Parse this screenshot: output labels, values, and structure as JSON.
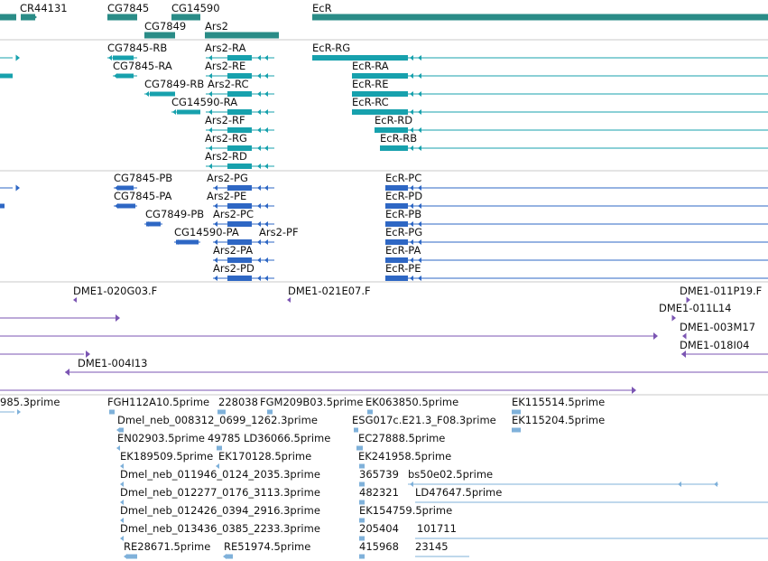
{
  "colors": {
    "gene": "#2a8c87",
    "transcript": "#17a1ad",
    "protein": "#2e67c4",
    "clone": "#7b55b3",
    "est": "#7fb1da",
    "separator": "#c8c8c8",
    "label": "#111111"
  },
  "icons": {
    "strand-forward": "small arrowhead pointing right",
    "strand-reverse": "small arrowhead pointing left"
  },
  "tracks": {
    "genes": {
      "labels": [
        "CR44131",
        "CG7845",
        "CG14590",
        "EcR",
        "CG7849",
        "Ars2"
      ]
    },
    "transcripts": {
      "labels": [
        "CG7845-RB",
        "Ars2-RA",
        "EcR-RG",
        "CG7845-RA",
        "Ars2-RE",
        "EcR-RA",
        "CG7849-RB",
        "Ars2-RC",
        "EcR-RE",
        "CG14590-RA",
        "EcR-RC",
        "Ars2-RF",
        "EcR-RD",
        "Ars2-RG",
        "EcR-RB",
        "Ars2-RD"
      ]
    },
    "proteins": {
      "labels": [
        "CG7845-PB",
        "Ars2-PG",
        "EcR-PC",
        "CG7845-PA",
        "Ars2-PE",
        "EcR-PD",
        "CG7849-PB",
        "Ars2-PC",
        "EcR-PB",
        "CG14590-PA",
        "Ars2-PF",
        "EcR-PG",
        "Ars2-PA",
        "EcR-PA",
        "Ars2-PD",
        "EcR-PE"
      ]
    },
    "clones": {
      "labels": [
        "DME1-020G03.F",
        "DME1-021E07.F",
        "DME1-011P19.F",
        "DME1-011L14",
        "DME1-003M17",
        "DME1-018I04",
        "DME1-004I13"
      ]
    },
    "ests": {
      "labels": [
        "985.3prime",
        "FGH112A10.5prime",
        "228038",
        "FGM209B03.5prime",
        "EK063850.5prime",
        "EK115514.5prime",
        "Dmel_neb_008312_0699_1262.3prime",
        "ESG017c.E21.3_F08.3prime",
        "EK115204.5prime",
        "EN02903.5prime",
        "49785",
        "LD36066.5prime",
        "EC27888.5prime",
        "EK189509.5prime",
        "EK170128.5prime",
        "EK241958.5prime",
        "Dmel_neb_011946_0124_2035.3prime",
        "365739",
        "bs50e02.5prime",
        "Dmel_neb_012277_0176_3113.3prime",
        "482321",
        "LD47647.5prime",
        "Dmel_neb_012426_0394_2916.3prime",
        "EK154759.5prime",
        "Dmel_neb_013436_0385_2233.3prime",
        "205404",
        "101711",
        "RE28671.5prime",
        "RE51974.5prime",
        "415968",
        "23145"
      ]
    }
  }
}
